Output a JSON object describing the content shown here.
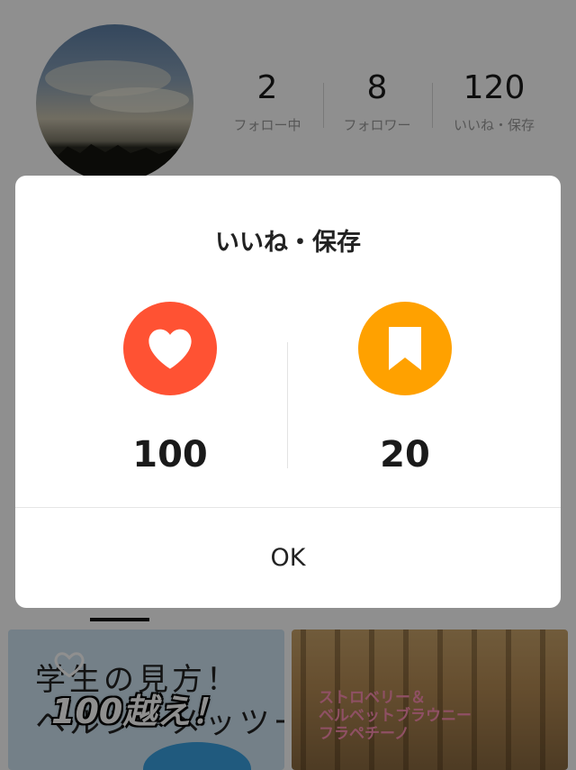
{
  "profile": {
    "stats": [
      {
        "value": "2",
        "label": "フォロー中"
      },
      {
        "value": "8",
        "label": "フォロワー"
      },
      {
        "value": "120",
        "label": "いいね・保存"
      }
    ]
  },
  "posts": [
    {
      "overlay_text": "100越え！",
      "handwriting": "学生の見方！\nヘルシーメッツー"
    },
    {
      "caption": "ストロベリー＆\nベルベットブラウニー\nフラペチーノ"
    }
  ],
  "dialog": {
    "title": "いいね・保存",
    "likes": {
      "count": "100",
      "icon": "heart-icon",
      "color": "#ff5233"
    },
    "saves": {
      "count": "20",
      "icon": "bookmark-icon",
      "color": "#ffa100"
    },
    "ok_label": "OK"
  }
}
